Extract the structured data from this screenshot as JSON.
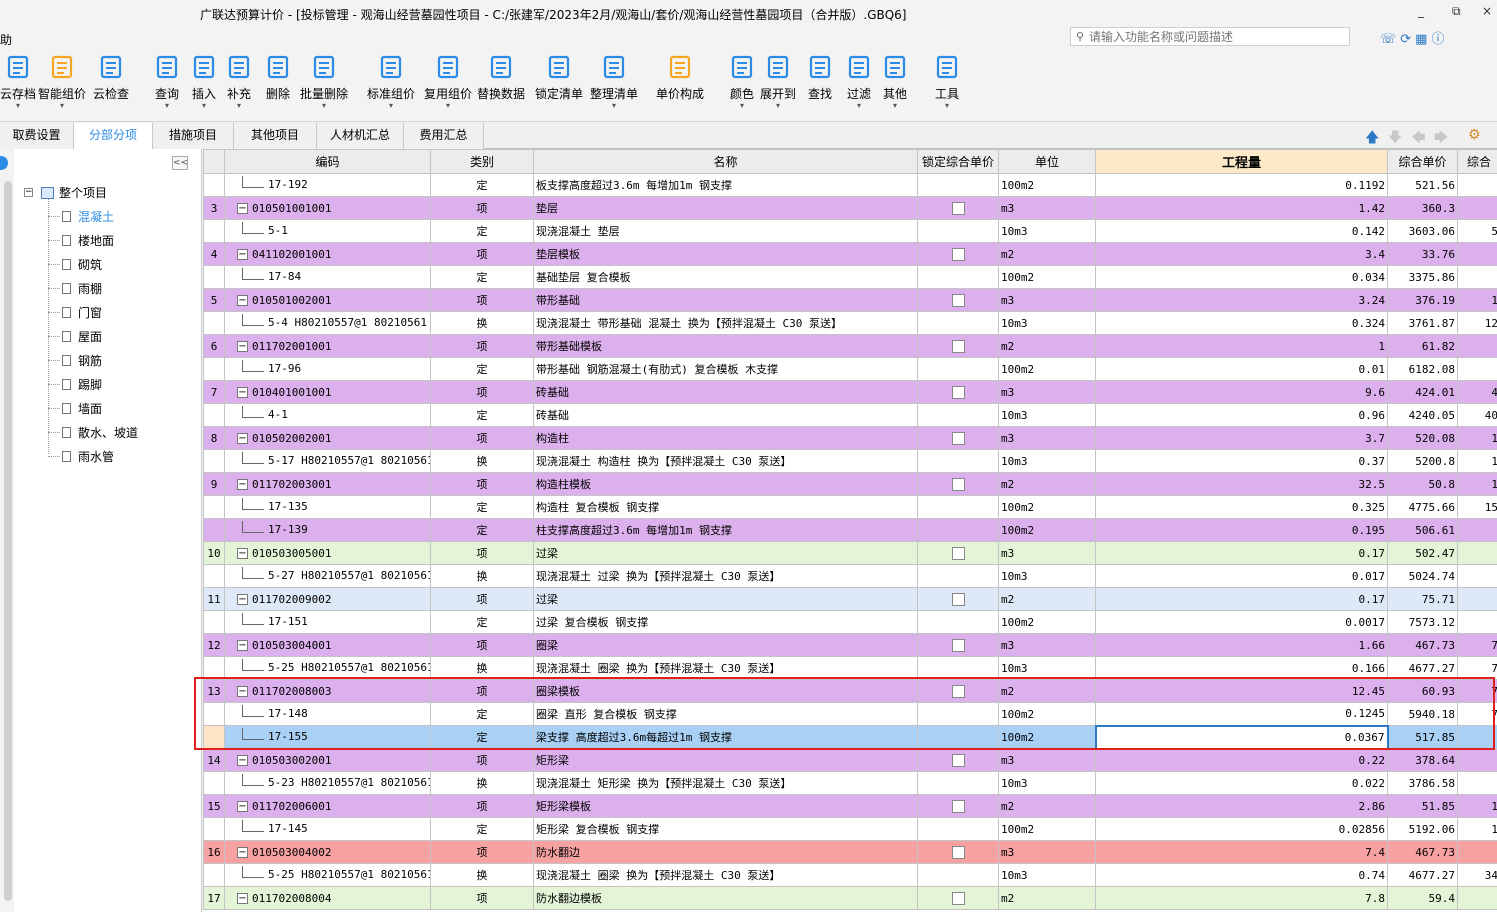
{
  "window": {
    "title": "广联达预算计价 - [投标管理 - 观海山经营墓园性项目 - C:/张建军/2023年2月/观海山/套价/观海山经营性墓园项目（合并版）.GBQ6]",
    "minimize": "_",
    "restore": "⧉",
    "close": "×"
  },
  "menubar": {
    "help": "帮助"
  },
  "search": {
    "placeholder": "请输入功能名称或问题描述"
  },
  "toolbar": {
    "items": [
      {
        "label": "云存档",
        "icon": "cloud-upload-icon"
      },
      {
        "label": "智能组价",
        "icon": "smart-pricing-icon"
      },
      {
        "label": "云检查",
        "icon": "cloud-check-icon"
      },
      {
        "label": "查询",
        "icon": "query-icon"
      },
      {
        "label": "插入",
        "icon": "insert-icon"
      },
      {
        "label": "补充",
        "icon": "supplement-icon"
      },
      {
        "label": "删除",
        "icon": "delete-icon"
      },
      {
        "label": "批量删除",
        "icon": "batch-delete-icon"
      },
      {
        "label": "标准组价",
        "icon": "standard-pricing-icon"
      },
      {
        "label": "复用组价",
        "icon": "reuse-pricing-icon"
      },
      {
        "label": "替换数据",
        "icon": "replace-data-icon"
      },
      {
        "label": "锁定清单",
        "icon": "lock-list-icon"
      },
      {
        "label": "整理清单",
        "icon": "organize-list-icon"
      },
      {
        "label": "单价构成",
        "icon": "unit-price-icon"
      },
      {
        "label": "颜色",
        "icon": "color-icon"
      },
      {
        "label": "展开到",
        "icon": "expand-to-icon"
      },
      {
        "label": "查找",
        "icon": "find-icon"
      },
      {
        "label": "过滤",
        "icon": "filter-icon"
      },
      {
        "label": "其他",
        "icon": "other-icon"
      },
      {
        "label": "工具",
        "icon": "tools-icon"
      }
    ]
  },
  "tabs": [
    {
      "label": "取费设置",
      "active": false
    },
    {
      "label": "分部分项",
      "active": true
    },
    {
      "label": "措施项目",
      "active": false
    },
    {
      "label": "其他项目",
      "active": false
    },
    {
      "label": "人材机汇总",
      "active": false
    },
    {
      "label": "费用汇总",
      "active": false
    }
  ],
  "sidebar": {
    "collapse": "<<",
    "root": "整个项目",
    "items": [
      "混凝土",
      "楼地面",
      "砌筑",
      "雨棚",
      "门窗",
      "屋面",
      "钢筋",
      "踢脚",
      "墙面",
      "散水、坡道",
      "雨水管"
    ],
    "selected": 0
  },
  "grid": {
    "headers": [
      "",
      "编码",
      "类别",
      "名称",
      "锁定综合单价",
      "单位",
      "工程量",
      "综合单价",
      "综合"
    ],
    "rows": [
      {
        "seq": "",
        "code": "17-192",
        "type": "定",
        "name": "板支撑高度超过3.6m 每增加1m 钢支撑",
        "unit": "100m2",
        "qty": "0.1192",
        "price": "521.56",
        "total": "",
        "kind": "child",
        "color": "white"
      },
      {
        "seq": "3",
        "code": "010501001001",
        "type": "项",
        "name": "垫层",
        "unit": "m3",
        "qty": "1.42",
        "price": "360.3",
        "total": "",
        "kind": "parent",
        "color": "purple"
      },
      {
        "seq": "",
        "code": "5-1",
        "type": "定",
        "name": "现浇混凝土 垫层",
        "unit": "10m3",
        "qty": "0.142",
        "price": "3603.06",
        "total": "5",
        "kind": "child",
        "color": "white"
      },
      {
        "seq": "4",
        "code": "041102001001",
        "type": "项",
        "name": "垫层模板",
        "unit": "m2",
        "qty": "3.4",
        "price": "33.76",
        "total": "",
        "kind": "parent",
        "color": "purple"
      },
      {
        "seq": "",
        "code": "17-84",
        "type": "定",
        "name": "基础垫层 复合模板",
        "unit": "100m2",
        "qty": "0.034",
        "price": "3375.86",
        "total": "",
        "kind": "child",
        "color": "white"
      },
      {
        "seq": "5",
        "code": "010501002001",
        "type": "项",
        "name": "带形基础",
        "unit": "m3",
        "qty": "3.24",
        "price": "376.19",
        "total": "1",
        "kind": "parent",
        "color": "purple"
      },
      {
        "seq": "",
        "code": "5-4 H80210557@1 80210561",
        "type": "换",
        "name": "现浇混凝土 带形基础 混凝土  换为【预拌混凝土 C30 泵送】",
        "unit": "10m3",
        "qty": "0.324",
        "price": "3761.87",
        "total": "12",
        "kind": "child",
        "color": "white"
      },
      {
        "seq": "6",
        "code": "011702001001",
        "type": "项",
        "name": "带形基础模板",
        "unit": "m2",
        "qty": "1",
        "price": "61.82",
        "total": "",
        "kind": "parent",
        "color": "purple"
      },
      {
        "seq": "",
        "code": "17-96",
        "type": "定",
        "name": "带形基础 钢筋混凝土(有肋式) 复合模板 木支撑",
        "unit": "100m2",
        "qty": "0.01",
        "price": "6182.08",
        "total": "",
        "kind": "child",
        "color": "white"
      },
      {
        "seq": "7",
        "code": "010401001001",
        "type": "项",
        "name": "砖基础",
        "unit": "m3",
        "qty": "9.6",
        "price": "424.01",
        "total": "4",
        "kind": "parent",
        "color": "purple"
      },
      {
        "seq": "",
        "code": "4-1",
        "type": "定",
        "name": "砖基础",
        "unit": "10m3",
        "qty": "0.96",
        "price": "4240.05",
        "total": "40",
        "kind": "child",
        "color": "white"
      },
      {
        "seq": "8",
        "code": "010502002001",
        "type": "项",
        "name": "构造柱",
        "unit": "m3",
        "qty": "3.7",
        "price": "520.08",
        "total": "1",
        "kind": "parent",
        "color": "purple"
      },
      {
        "seq": "",
        "code": "5-17 H80210557@1 80210561",
        "type": "换",
        "name": "现浇混凝土 构造柱  换为【预拌混凝土 C30 泵送】",
        "unit": "10m3",
        "qty": "0.37",
        "price": "5200.8",
        "total": "1",
        "kind": "child",
        "color": "white"
      },
      {
        "seq": "9",
        "code": "011702003001",
        "type": "项",
        "name": "构造柱模板",
        "unit": "m2",
        "qty": "32.5",
        "price": "50.8",
        "total": "1",
        "kind": "parent",
        "color": "purple"
      },
      {
        "seq": "",
        "code": "17-135",
        "type": "定",
        "name": "构造柱 复合模板 钢支撑",
        "unit": "100m2",
        "qty": "0.325",
        "price": "4775.66",
        "total": "15",
        "kind": "child",
        "color": "white"
      },
      {
        "seq": "",
        "code": "17-139",
        "type": "定",
        "name": "柱支撑高度超过3.6m 每增加1m 钢支撑",
        "unit": "100m2",
        "qty": "0.195",
        "price": "506.61",
        "total": "",
        "kind": "child",
        "color": "purple"
      },
      {
        "seq": "10",
        "code": "010503005001",
        "type": "项",
        "name": "过梁",
        "unit": "m3",
        "qty": "0.17",
        "price": "502.47",
        "total": "",
        "kind": "parent",
        "color": "green"
      },
      {
        "seq": "",
        "code": "5-27 H80210557@1 80210561",
        "type": "换",
        "name": "现浇混凝土 过梁  换为【预拌混凝土 C30 泵送】",
        "unit": "10m3",
        "qty": "0.017",
        "price": "5024.74",
        "total": "",
        "kind": "child",
        "color": "white"
      },
      {
        "seq": "11",
        "code": "011702009002",
        "type": "项",
        "name": "过梁",
        "unit": "m2",
        "qty": "0.17",
        "price": "75.71",
        "total": "",
        "kind": "parent",
        "color": "lblue"
      },
      {
        "seq": "",
        "code": "17-151",
        "type": "定",
        "name": "过梁 复合模板 钢支撑",
        "unit": "100m2",
        "qty": "0.0017",
        "price": "7573.12",
        "total": "",
        "kind": "child",
        "color": "white"
      },
      {
        "seq": "12",
        "code": "010503004001",
        "type": "项",
        "name": "圈梁",
        "unit": "m3",
        "qty": "1.66",
        "price": "467.73",
        "total": "7",
        "kind": "parent",
        "color": "purple"
      },
      {
        "seq": "",
        "code": "5-25 H80210557@1 80210561",
        "type": "换",
        "name": "现浇混凝土 圈梁  换为【预拌混凝土 C30 泵送】",
        "unit": "10m3",
        "qty": "0.166",
        "price": "4677.27",
        "total": "7",
        "kind": "child",
        "color": "white"
      },
      {
        "seq": "13",
        "code": "011702008003",
        "type": "项",
        "name": "圈梁模板",
        "unit": "m2",
        "qty": "12.45",
        "price": "60.93",
        "total": "7",
        "kind": "parent",
        "color": "purple"
      },
      {
        "seq": "",
        "code": "17-148",
        "type": "定",
        "name": "圈梁 直形 复合模板 钢支撑",
        "unit": "100m2",
        "qty": "0.1245",
        "price": "5940.18",
        "total": "7",
        "kind": "child",
        "color": "white"
      },
      {
        "seq": "",
        "code": "17-155",
        "type": "定",
        "name": "梁支撑 高度超过3.6m每超过1m 钢支撑",
        "unit": "100m2",
        "qty": "0.0367",
        "price": "517.85",
        "total": "",
        "kind": "child",
        "color": "sel"
      },
      {
        "seq": "14",
        "code": "010503002001",
        "type": "项",
        "name": "矩形梁",
        "unit": "m3",
        "qty": "0.22",
        "price": "378.64",
        "total": "",
        "kind": "parent",
        "color": "purple"
      },
      {
        "seq": "",
        "code": "5-23 H80210557@1 80210561",
        "type": "换",
        "name": "现浇混凝土 矩形梁  换为【预拌混凝土 C30 泵送】",
        "unit": "10m3",
        "qty": "0.022",
        "price": "3786.58",
        "total": "",
        "kind": "child",
        "color": "white"
      },
      {
        "seq": "15",
        "code": "011702006001",
        "type": "项",
        "name": "矩形梁模板",
        "unit": "m2",
        "qty": "2.86",
        "price": "51.85",
        "total": "1",
        "kind": "parent",
        "color": "purple"
      },
      {
        "seq": "",
        "code": "17-145",
        "type": "定",
        "name": "矩形梁 复合模板 钢支撑",
        "unit": "100m2",
        "qty": "0.02856",
        "price": "5192.06",
        "total": "1",
        "kind": "child",
        "color": "white"
      },
      {
        "seq": "16",
        "code": "010503004002",
        "type": "项",
        "name": "防水翻边",
        "unit": "m3",
        "qty": "7.4",
        "price": "467.73",
        "total": "",
        "kind": "parent",
        "color": "red"
      },
      {
        "seq": "",
        "code": "5-25 H80210557@1 80210561",
        "type": "换",
        "name": "现浇混凝土 圈梁  换为【预拌混凝土 C30 泵送】",
        "unit": "10m3",
        "qty": "0.74",
        "price": "4677.27",
        "total": "34",
        "kind": "child",
        "color": "white"
      },
      {
        "seq": "17",
        "code": "011702008004",
        "type": "项",
        "name": "防水翻边模板",
        "unit": "m2",
        "qty": "7.8",
        "price": "59.4",
        "total": "",
        "kind": "parent",
        "color": "green"
      }
    ]
  },
  "colors": {
    "accent": "#2b8be6",
    "purple_row": "#dcb0ec",
    "green_row": "#e3f4d7",
    "light_blue_row": "#dde9f6",
    "red_row": "#f7a2a2",
    "selected_row": "#a9d0f5",
    "highlight_box": "#e02020"
  }
}
